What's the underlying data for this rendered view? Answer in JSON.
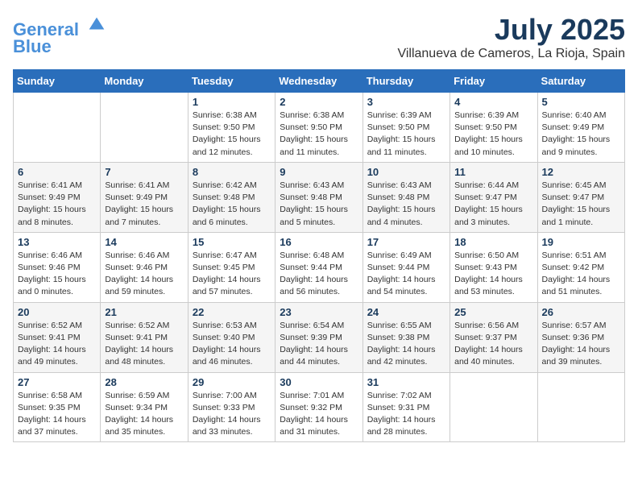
{
  "header": {
    "logo_line1": "General",
    "logo_line2": "Blue",
    "month": "July 2025",
    "location": "Villanueva de Cameros, La Rioja, Spain"
  },
  "weekdays": [
    "Sunday",
    "Monday",
    "Tuesday",
    "Wednesday",
    "Thursday",
    "Friday",
    "Saturday"
  ],
  "weeks": [
    [
      {
        "day": "",
        "info": ""
      },
      {
        "day": "",
        "info": ""
      },
      {
        "day": "1",
        "info": "Sunrise: 6:38 AM\nSunset: 9:50 PM\nDaylight: 15 hours and 12 minutes."
      },
      {
        "day": "2",
        "info": "Sunrise: 6:38 AM\nSunset: 9:50 PM\nDaylight: 15 hours and 11 minutes."
      },
      {
        "day": "3",
        "info": "Sunrise: 6:39 AM\nSunset: 9:50 PM\nDaylight: 15 hours and 11 minutes."
      },
      {
        "day": "4",
        "info": "Sunrise: 6:39 AM\nSunset: 9:50 PM\nDaylight: 15 hours and 10 minutes."
      },
      {
        "day": "5",
        "info": "Sunrise: 6:40 AM\nSunset: 9:49 PM\nDaylight: 15 hours and 9 minutes."
      }
    ],
    [
      {
        "day": "6",
        "info": "Sunrise: 6:41 AM\nSunset: 9:49 PM\nDaylight: 15 hours and 8 minutes."
      },
      {
        "day": "7",
        "info": "Sunrise: 6:41 AM\nSunset: 9:49 PM\nDaylight: 15 hours and 7 minutes."
      },
      {
        "day": "8",
        "info": "Sunrise: 6:42 AM\nSunset: 9:48 PM\nDaylight: 15 hours and 6 minutes."
      },
      {
        "day": "9",
        "info": "Sunrise: 6:43 AM\nSunset: 9:48 PM\nDaylight: 15 hours and 5 minutes."
      },
      {
        "day": "10",
        "info": "Sunrise: 6:43 AM\nSunset: 9:48 PM\nDaylight: 15 hours and 4 minutes."
      },
      {
        "day": "11",
        "info": "Sunrise: 6:44 AM\nSunset: 9:47 PM\nDaylight: 15 hours and 3 minutes."
      },
      {
        "day": "12",
        "info": "Sunrise: 6:45 AM\nSunset: 9:47 PM\nDaylight: 15 hours and 1 minute."
      }
    ],
    [
      {
        "day": "13",
        "info": "Sunrise: 6:46 AM\nSunset: 9:46 PM\nDaylight: 15 hours and 0 minutes."
      },
      {
        "day": "14",
        "info": "Sunrise: 6:46 AM\nSunset: 9:46 PM\nDaylight: 14 hours and 59 minutes."
      },
      {
        "day": "15",
        "info": "Sunrise: 6:47 AM\nSunset: 9:45 PM\nDaylight: 14 hours and 57 minutes."
      },
      {
        "day": "16",
        "info": "Sunrise: 6:48 AM\nSunset: 9:44 PM\nDaylight: 14 hours and 56 minutes."
      },
      {
        "day": "17",
        "info": "Sunrise: 6:49 AM\nSunset: 9:44 PM\nDaylight: 14 hours and 54 minutes."
      },
      {
        "day": "18",
        "info": "Sunrise: 6:50 AM\nSunset: 9:43 PM\nDaylight: 14 hours and 53 minutes."
      },
      {
        "day": "19",
        "info": "Sunrise: 6:51 AM\nSunset: 9:42 PM\nDaylight: 14 hours and 51 minutes."
      }
    ],
    [
      {
        "day": "20",
        "info": "Sunrise: 6:52 AM\nSunset: 9:41 PM\nDaylight: 14 hours and 49 minutes."
      },
      {
        "day": "21",
        "info": "Sunrise: 6:52 AM\nSunset: 9:41 PM\nDaylight: 14 hours and 48 minutes."
      },
      {
        "day": "22",
        "info": "Sunrise: 6:53 AM\nSunset: 9:40 PM\nDaylight: 14 hours and 46 minutes."
      },
      {
        "day": "23",
        "info": "Sunrise: 6:54 AM\nSunset: 9:39 PM\nDaylight: 14 hours and 44 minutes."
      },
      {
        "day": "24",
        "info": "Sunrise: 6:55 AM\nSunset: 9:38 PM\nDaylight: 14 hours and 42 minutes."
      },
      {
        "day": "25",
        "info": "Sunrise: 6:56 AM\nSunset: 9:37 PM\nDaylight: 14 hours and 40 minutes."
      },
      {
        "day": "26",
        "info": "Sunrise: 6:57 AM\nSunset: 9:36 PM\nDaylight: 14 hours and 39 minutes."
      }
    ],
    [
      {
        "day": "27",
        "info": "Sunrise: 6:58 AM\nSunset: 9:35 PM\nDaylight: 14 hours and 37 minutes."
      },
      {
        "day": "28",
        "info": "Sunrise: 6:59 AM\nSunset: 9:34 PM\nDaylight: 14 hours and 35 minutes."
      },
      {
        "day": "29",
        "info": "Sunrise: 7:00 AM\nSunset: 9:33 PM\nDaylight: 14 hours and 33 minutes."
      },
      {
        "day": "30",
        "info": "Sunrise: 7:01 AM\nSunset: 9:32 PM\nDaylight: 14 hours and 31 minutes."
      },
      {
        "day": "31",
        "info": "Sunrise: 7:02 AM\nSunset: 9:31 PM\nDaylight: 14 hours and 28 minutes."
      },
      {
        "day": "",
        "info": ""
      },
      {
        "day": "",
        "info": ""
      }
    ]
  ]
}
